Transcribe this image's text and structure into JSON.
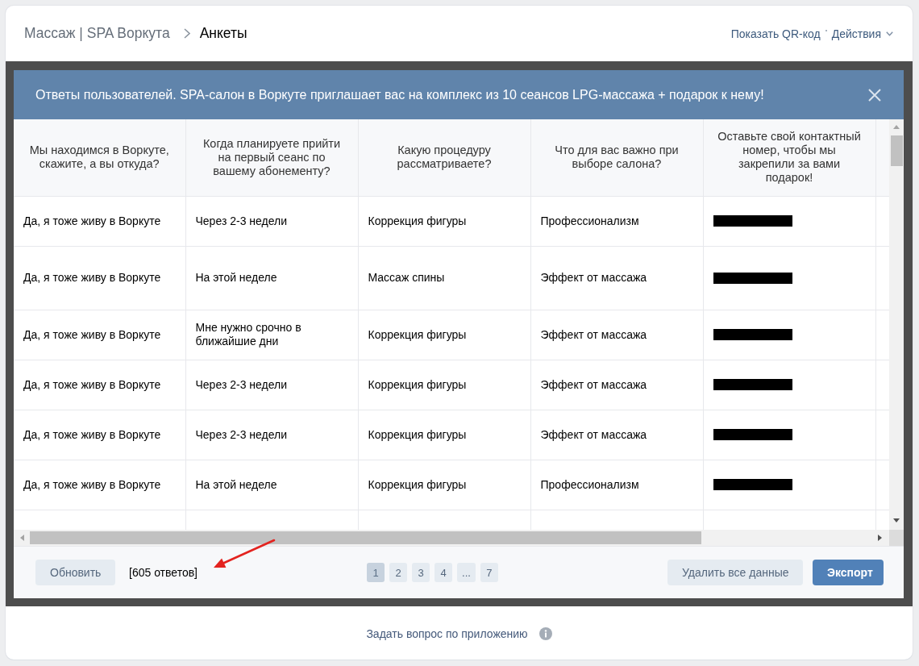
{
  "header": {
    "breadcrumbs": [
      "Массаж | SPA Воркута",
      "Анкеты"
    ],
    "qr_link": "Показать QR-код",
    "actions_menu": "Действия"
  },
  "modal": {
    "title": "Ответы пользователей. SPA-салон в Воркуте приглашает вас на комплекс из 10 сеансов LPG-массажа + подарок к нему!",
    "table": {
      "columns": [
        "Мы находимся в Воркуте, скажите, а вы откуда?",
        "Когда планируете прийти на первый сеанс по вашему абонементу?",
        "Какую процедуру рассматриваете?",
        "Что для вас важно при выборе салона?",
        "Оставьте свой контактный номер, чтобы мы закрепили за вами подарок!"
      ],
      "rows": [
        {
          "cells": [
            "Да, я тоже живу в Воркуте",
            "Через 2-3 недели",
            "Коррекция фигуры",
            "Профессионализм"
          ],
          "contact_redacted": true
        },
        {
          "cells": [
            "Да, я тоже живу в Воркуте",
            "На этой неделе",
            "Массаж спины",
            "Эффект от массажа"
          ],
          "contact_redacted": true
        },
        {
          "cells": [
            "Да, я тоже живу в Воркуте",
            "Мне нужно срочно в ближайшие дни",
            "Коррекция фигуры",
            "Эффект от массажа"
          ],
          "contact_redacted": true
        },
        {
          "cells": [
            "Да, я тоже живу в Воркуте",
            "Через 2-3 недели",
            "Коррекция фигуры",
            "Эффект от массажа"
          ],
          "contact_redacted": true
        },
        {
          "cells": [
            "Да, я тоже живу в Воркуте",
            "Через 2-3 недели",
            "Коррекция фигуры",
            "Эффект от массажа"
          ],
          "contact_redacted": true
        },
        {
          "cells": [
            "Да, я тоже живу в Воркуте",
            "На этой неделе",
            "Коррекция фигуры",
            "Профессионализм"
          ],
          "contact_redacted": true
        }
      ]
    },
    "footer": {
      "refresh_button": "Обновить",
      "count": "[605 ответов]",
      "pages": [
        {
          "label": "1",
          "selected": true
        },
        {
          "label": "2",
          "selected": false
        },
        {
          "label": "3",
          "selected": false
        },
        {
          "label": "4",
          "selected": false
        },
        {
          "label": "...",
          "selected": false
        },
        {
          "label": "7",
          "selected": false
        }
      ],
      "delete_button": "Удалить все данные",
      "export_button": "Экспорт"
    }
  },
  "help": {
    "link": "Задать вопрос по приложению"
  }
}
